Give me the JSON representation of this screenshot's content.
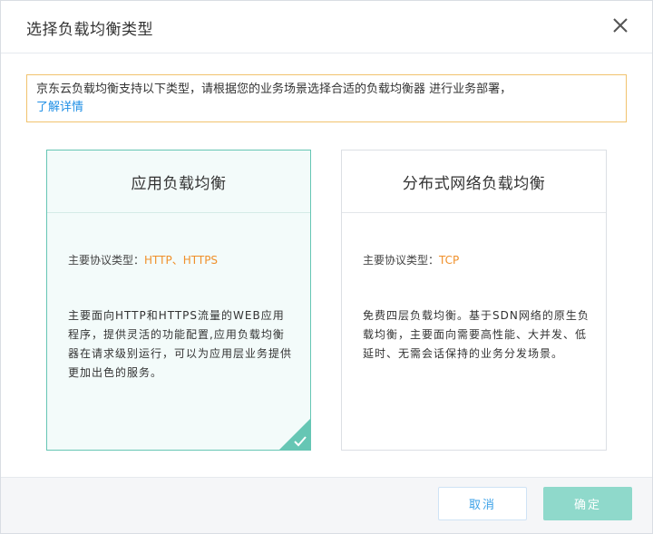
{
  "dialog": {
    "title": "选择负载均衡类型",
    "close_icon": "close-icon"
  },
  "notice": {
    "text": "京东云负载均衡支持以下类型，请根据您的业务场景选择合适的负载均衡器 进行业务部署，",
    "link": "了解详情"
  },
  "cards": [
    {
      "title": "应用负载均衡",
      "protocol_label": "主要协议类型：",
      "protocol_value": "HTTP、HTTPS",
      "description": "主要面向HTTP和HTTPS流量的WEB应用程序，提供灵活的功能配置,应用负载均衡器在请求级别运行，可以为应用层业务提供更加出色的服务。",
      "selected": true,
      "selected_icon": "check-icon"
    },
    {
      "title": "分布式网络负载均衡",
      "protocol_label": "主要协议类型：",
      "protocol_value": "TCP",
      "description": "免费四层负载均衡。基于SDN网络的原生负载均衡，主要面向需要高性能、大并发、低延时、无需会话保持的业务分发场景。",
      "selected": false
    }
  ],
  "footer": {
    "cancel_label": "取消",
    "ok_label": "确定"
  },
  "colors": {
    "accent_teal": "#66c6b4",
    "notice_border": "#f1c36e",
    "link_blue": "#1f8fe5",
    "protocol_orange": "#f0902a",
    "ok_button": "#8fd9cb"
  }
}
